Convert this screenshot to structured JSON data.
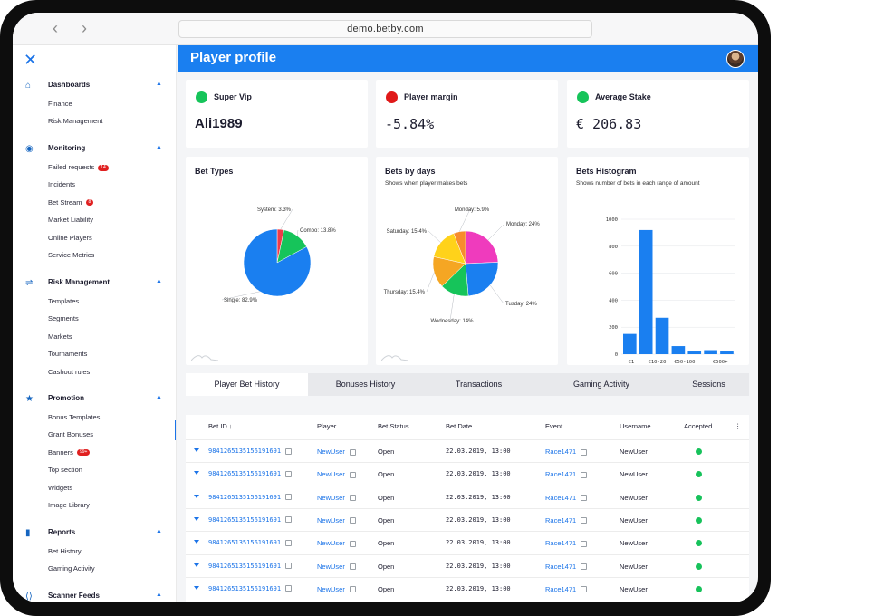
{
  "browser": {
    "url": "demo.betby.com",
    "back": "‹",
    "forward": "›"
  },
  "sidebar": {
    "sections": [
      {
        "title": "Dashboards",
        "icon": "home-icon",
        "items": [
          {
            "label": "Finance"
          },
          {
            "label": "Risk Management"
          }
        ]
      },
      {
        "title": "Monitoring",
        "icon": "eye-icon",
        "items": [
          {
            "label": "Failed requests",
            "badge": "14"
          },
          {
            "label": "Incidents"
          },
          {
            "label": "Bet Stream",
            "badge": "8"
          },
          {
            "label": "Market Liability"
          },
          {
            "label": "Online Players"
          },
          {
            "label": "Service Metrics"
          }
        ]
      },
      {
        "title": "Risk Management",
        "icon": "sliders-icon",
        "items": [
          {
            "label": "Templates"
          },
          {
            "label": "Segments"
          },
          {
            "label": "Markets"
          },
          {
            "label": "Tournaments"
          },
          {
            "label": "Cashout rules"
          }
        ]
      },
      {
        "title": "Promotion",
        "icon": "star-icon",
        "items": [
          {
            "label": "Bonus Templates"
          },
          {
            "label": "Grant Bonuses"
          },
          {
            "label": "Banners",
            "badge": "99+"
          },
          {
            "label": "Top section"
          },
          {
            "label": "Widgets"
          },
          {
            "label": "Image Library"
          }
        ]
      },
      {
        "title": "Reports",
        "icon": "bar-chart-icon",
        "items": [
          {
            "label": "Bet History"
          },
          {
            "label": "Gaming Activity"
          }
        ]
      },
      {
        "title": "Scanner Feeds",
        "icon": "code-icon",
        "items": []
      }
    ]
  },
  "header": {
    "title": "Player profile"
  },
  "stats": [
    {
      "label": "Super Vip",
      "value": "Ali1989",
      "color": "#16c45a"
    },
    {
      "label": "Player margin",
      "value": "-5.84%",
      "color": "#e01919"
    },
    {
      "label": "Average Stake",
      "value": "€ 206.83",
      "color": "#16c45a"
    }
  ],
  "charts": {
    "bet_types": {
      "title": "Bet Types"
    },
    "bets_by_days": {
      "title": "Bets by days",
      "subtitle": "Shows when player makes bets"
    },
    "histogram": {
      "title": "Bets Histogram",
      "subtitle": "Shows number of bets in each range of amount"
    }
  },
  "chart_data": [
    {
      "type": "pie",
      "title": "Bet Types",
      "labels": [
        "Single",
        "Combo",
        "System"
      ],
      "values": [
        82.9,
        13.8,
        3.3
      ],
      "display_labels": [
        "Single: 82.9%",
        "Combo: 13.8%",
        "System: 3.3%"
      ],
      "colors": [
        "#1a7ff0",
        "#16c45a",
        "#ef3b4a"
      ]
    },
    {
      "type": "pie",
      "title": "Bets by days",
      "subtitle": "Shows when player makes bets",
      "labels": [
        "Monday",
        "Tusday",
        "Wednesday",
        "Thursday",
        "Saturday",
        "Monday"
      ],
      "values": [
        24,
        24,
        14,
        15.4,
        15.4,
        5.9
      ],
      "display_labels": [
        "Monday: 24%",
        "Tusday: 24%",
        "Wednesday: 14%",
        "Thursday: 15.4%",
        "Saturday: 15.4%",
        "Monday: 5.9%"
      ],
      "colors": [
        "#ef3bbd",
        "#1a7ff0",
        "#16c45a",
        "#f5a623",
        "#ffd21a",
        "#f78c2c"
      ]
    },
    {
      "type": "bar",
      "title": "Bets Histogram",
      "subtitle": "Shows number of bets in each range of amount",
      "categories": [
        "€1",
        "€10-20",
        "",
        "€50-100",
        "",
        "€500+"
      ],
      "values": [
        150,
        920,
        270,
        60,
        20,
        30,
        20
      ],
      "ylim": [
        0,
        1000
      ],
      "yticks": [
        "0",
        "200",
        "400",
        "600",
        "800",
        "1000"
      ],
      "xtick_labels": [
        "€1",
        "€10-20",
        "€50-100",
        "€500+"
      ],
      "color": "#1a7ff0",
      "grid": true
    }
  ],
  "tabs": [
    {
      "label": "Player Bet History",
      "active": true
    },
    {
      "label": "Bonuses History",
      "active": false
    },
    {
      "label": "Transactions",
      "active": false
    },
    {
      "label": "Gaming Activity",
      "active": false
    },
    {
      "label": "Sessions",
      "active": false
    }
  ],
  "table": {
    "columns": [
      "Bet ID ↓",
      "Player",
      "Bet Status",
      "Bet Date",
      "Event",
      "Username",
      "Accepted",
      "⋮"
    ],
    "rows": [
      {
        "bet_id": "9841265135156191691",
        "player": "NewUser",
        "status": "Open",
        "date": "22.03.2019, 13:00",
        "event": "Race1471",
        "username": "NewUser"
      },
      {
        "bet_id": "9841265135156191691",
        "player": "NewUser",
        "status": "Open",
        "date": "22.03.2019, 13:00",
        "event": "Race1471",
        "username": "NewUser"
      },
      {
        "bet_id": "9841265135156191691",
        "player": "NewUser",
        "status": "Open",
        "date": "22.03.2019, 13:00",
        "event": "Race1471",
        "username": "NewUser"
      },
      {
        "bet_id": "9841265135156191691",
        "player": "NewUser",
        "status": "Open",
        "date": "22.03.2019, 13:00",
        "event": "Race1471",
        "username": "NewUser"
      },
      {
        "bet_id": "9841265135156191691",
        "player": "NewUser",
        "status": "Open",
        "date": "22.03.2019, 13:00",
        "event": "Race1471",
        "username": "NewUser"
      },
      {
        "bet_id": "9841265135156191691",
        "player": "NewUser",
        "status": "Open",
        "date": "22.03.2019, 13:00",
        "event": "Race1471",
        "username": "NewUser"
      },
      {
        "bet_id": "9841265135156191691",
        "player": "NewUser",
        "status": "Open",
        "date": "22.03.2019, 13:00",
        "event": "Race1471",
        "username": "NewUser"
      }
    ]
  }
}
